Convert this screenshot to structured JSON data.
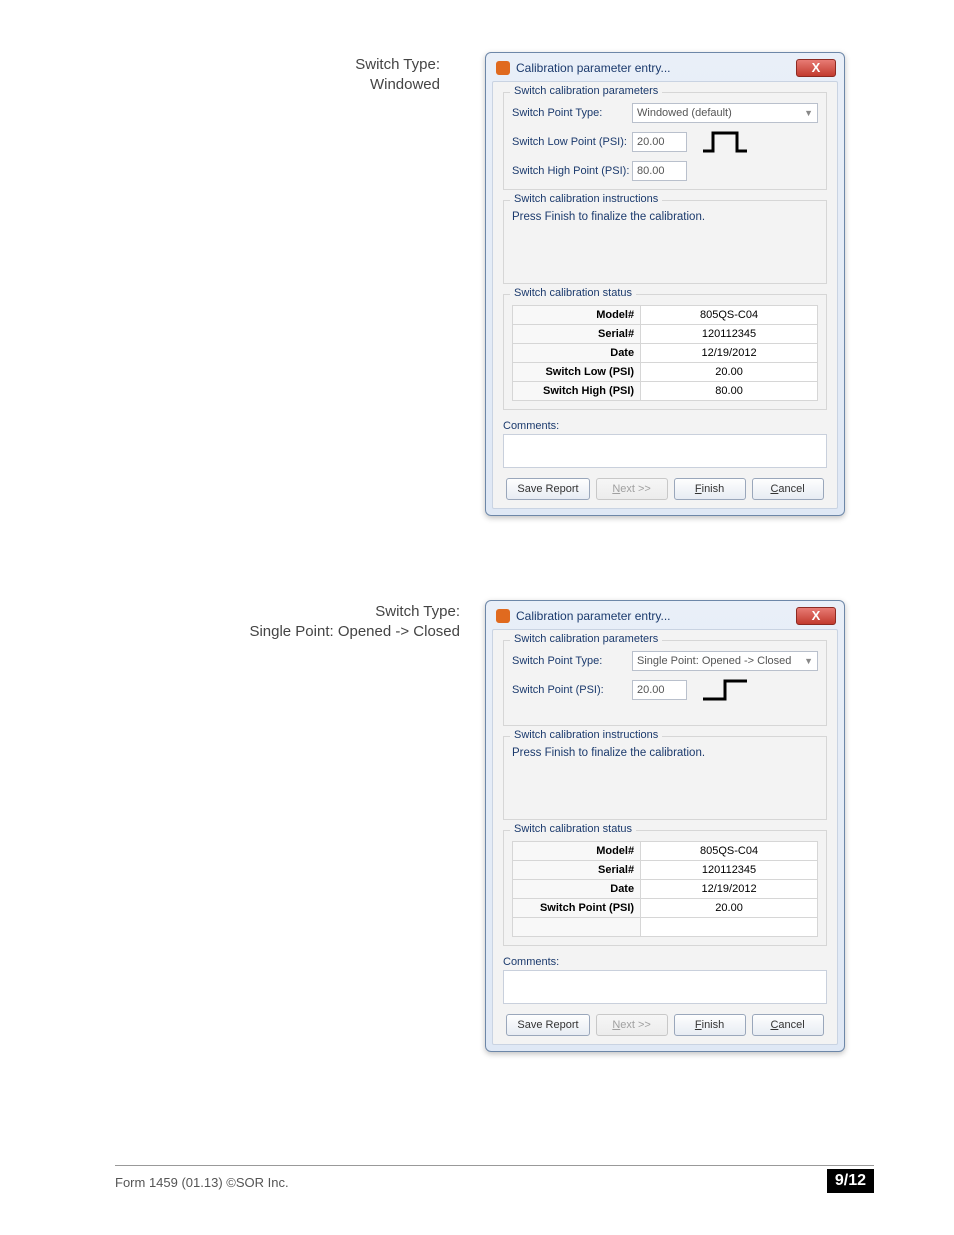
{
  "captions": {
    "c1_line1": "Switch Type:",
    "c1_line2": "Windowed",
    "c2_line1": "Switch Type:",
    "c2_line2": "Single Point: Opened -> Closed"
  },
  "dialog_shared": {
    "title": "Calibration parameter entry...",
    "close_x": "X",
    "group_params": "Switch calibration parameters",
    "group_instr": "Switch calibration instructions",
    "group_status": "Switch calibration status",
    "instr_text": "Press Finish to finalize the calibration.",
    "comments_label": "Comments:",
    "btn_save": "Save Report",
    "btn_next": "Next >>",
    "btn_finish_f": "F",
    "btn_finish_rest": "inish",
    "btn_cancel_c": "C",
    "btn_cancel_rest": "ancel",
    "next_u": "N",
    "next_rest": "ext >>"
  },
  "dlg1": {
    "lbl_point_type": "Switch Point Type:",
    "val_point_type": "Windowed (default)",
    "lbl_low": "Switch Low Point (PSI):",
    "val_low": "20.00",
    "lbl_high": "Switch High Point (PSI):",
    "val_high": "80.00",
    "status": {
      "k1": "Model#",
      "v1": "805QS-C04",
      "k2": "Serial#",
      "v2": "120112345",
      "k3": "Date",
      "v3": "12/19/2012",
      "k4": "Switch Low (PSI)",
      "v4": "20.00",
      "k5": "Switch High (PSI)",
      "v5": "80.00"
    }
  },
  "dlg2": {
    "lbl_point_type": "Switch Point Type:",
    "val_point_type": "Single Point: Opened -> Closed",
    "lbl_sp": "Switch Point (PSI):",
    "val_sp": "20.00",
    "status": {
      "k1": "Model#",
      "v1": "805QS-C04",
      "k2": "Serial#",
      "v2": "120112345",
      "k3": "Date",
      "v3": "12/19/2012",
      "k4": "Switch Point (PSI)",
      "v4": "20.00"
    }
  },
  "chart_data": [
    {
      "type": "line",
      "title": "Windowed switch glyph",
      "x": [
        0,
        0.25,
        0.25,
        0.75,
        0.75,
        1.0
      ],
      "y": [
        0,
        0,
        1,
        1,
        0,
        0
      ],
      "xlabel": "",
      "ylabel": "",
      "ylim": [
        0,
        1
      ]
    },
    {
      "type": "line",
      "title": "Single point Opened→Closed glyph",
      "x": [
        0,
        0.5,
        0.5,
        1.0
      ],
      "y": [
        0,
        0,
        1,
        1
      ],
      "xlabel": "",
      "ylabel": "",
      "ylim": [
        0,
        1
      ]
    }
  ],
  "footer": {
    "left": "Form 1459 (01.13) ©SOR Inc.",
    "right": "9/12"
  }
}
